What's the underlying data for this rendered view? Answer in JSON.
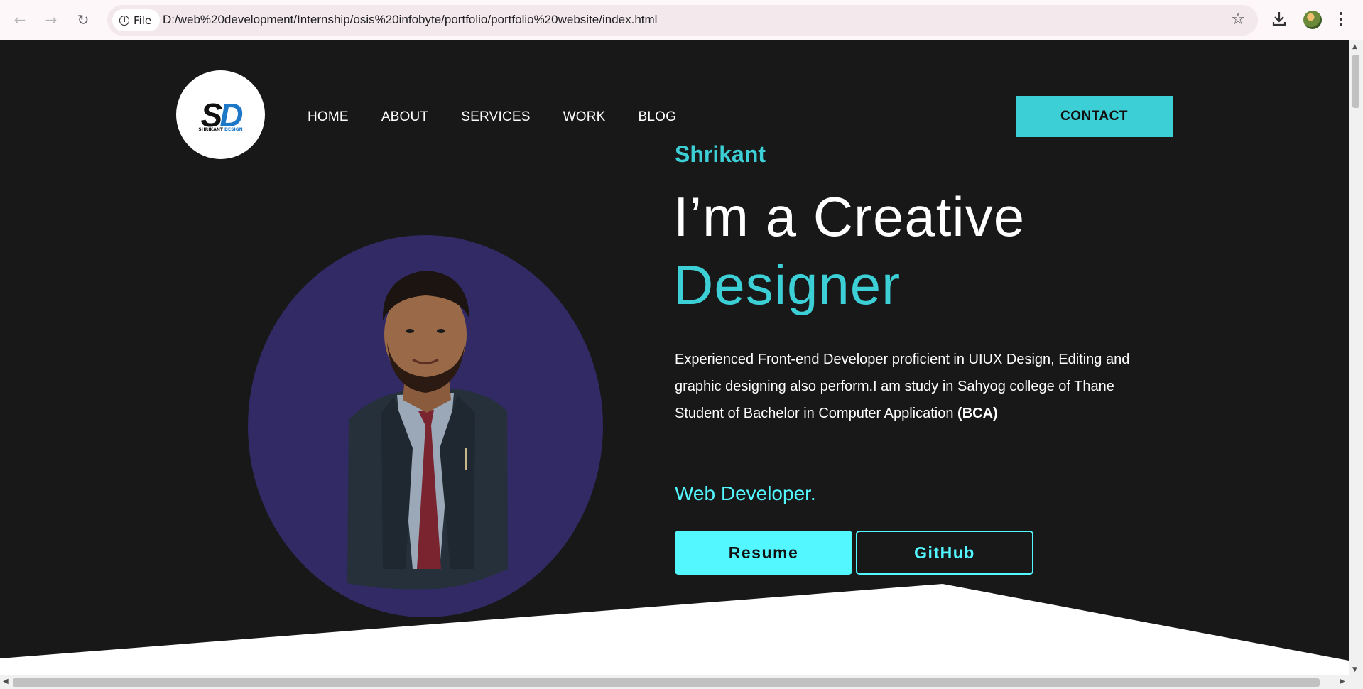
{
  "browser": {
    "site_chip": "File",
    "url": "D:/web%20development/Internship/osis%20infobyte/portfolio/portfolio%20website/index.html",
    "back_icon": "back-arrow-icon",
    "forward_icon": "forward-arrow-icon",
    "reload_icon": "reload-icon",
    "bookmark_icon": "star-icon",
    "download_icon": "download-icon",
    "menu_icon": "kebab-menu-icon"
  },
  "header": {
    "logo": {
      "mark_left": "S",
      "mark_right": "D",
      "caption_left": "SHRIKANT",
      "caption_right": "DESIGN"
    },
    "nav": [
      "HOME",
      "ABOUT",
      "SERVICES",
      "WORK",
      "BLOG"
    ],
    "contact_label": "CONTACT"
  },
  "hero": {
    "name": "Shrikant",
    "headline_line1": "I’m a Creative",
    "headline_line2": "Designer",
    "bio_line1": "Experienced Front-end Developer proficient in UIUX Design, Editing and graphic designing also perform.I am study in Sahyog college of Thane",
    "bio_line2_prefix": "Student of Bachelor in Computer Application ",
    "bio_line2_bold": "(BCA)",
    "role": "Web Developer.",
    "resume_label": "Resume",
    "github_label": "GitHub"
  },
  "colors": {
    "accent": "#3ccfd6",
    "accent_bright": "#52f7ff",
    "background": "#181818",
    "circle": "#312a64"
  }
}
